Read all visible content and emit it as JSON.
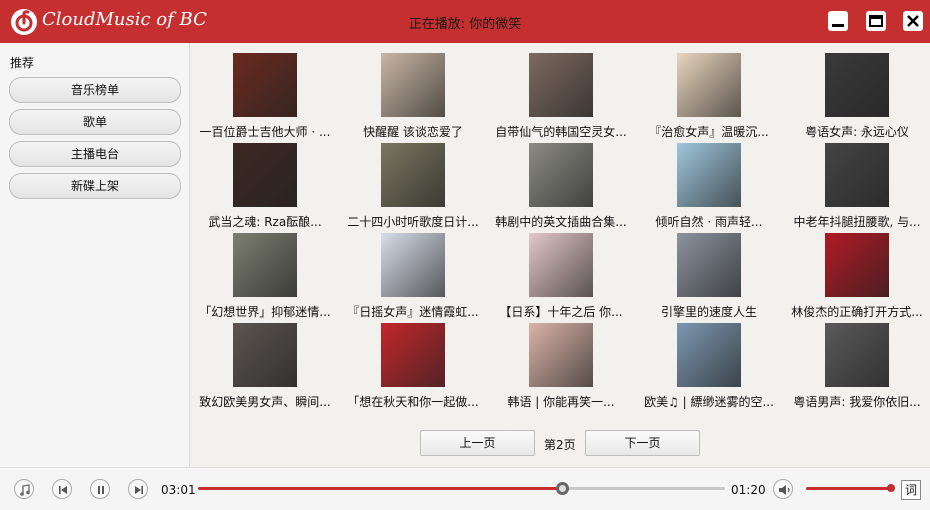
{
  "app": {
    "title": "CloudMusic of BC",
    "now_playing": "正在播放: 你的微笑"
  },
  "window_controls": {
    "minimize": "minimize-icon",
    "maximize": "maximize-icon",
    "close": "close-icon"
  },
  "sidebar": {
    "heading": "推荐",
    "items": [
      {
        "label": "音乐榜单"
      },
      {
        "label": "歌单"
      },
      {
        "label": "主播电台"
      },
      {
        "label": "新碟上架"
      }
    ]
  },
  "playlists": [
    {
      "title": "一百位爵士吉他大师 · ...",
      "color": "#6a2a20"
    },
    {
      "title": "快醒醒 该谈恋爱了",
      "color": "#c9b6a4"
    },
    {
      "title": "自带仙气的韩国空灵女...",
      "color": "#7d6a5f"
    },
    {
      "title": "『治愈女声』温暖沉...",
      "color": "#e8d5bd"
    },
    {
      "title": "粤语女声: 永远心仪",
      "color": "#3a3a3a"
    },
    {
      "title": "武当之魂: Rza酝酿...",
      "color": "#3d2822"
    },
    {
      "title": "二十四小时听歌度日计...",
      "color": "#7a7660"
    },
    {
      "title": "韩剧中的英文插曲合集...",
      "color": "#8c8c84"
    },
    {
      "title": "倾听自然 · 雨声轻...",
      "color": "#9fc6dc"
    },
    {
      "title": "中老年抖腿扭腰歌, 与...",
      "color": "#444444"
    },
    {
      "title": "「幻想世界」抑郁迷情...",
      "color": "#7c7f70"
    },
    {
      "title": "『日摇女声』迷情霞虹...",
      "color": "#d8dde8"
    },
    {
      "title": "【日系】十年之后 你...",
      "color": "#e3c7c7"
    },
    {
      "title": "引擎里的速度人生",
      "color": "#8b939e"
    },
    {
      "title": "林俊杰的正确打开方式...",
      "color": "#b01a24"
    },
    {
      "title": "致幻欧美男女声、瞬间...",
      "color": "#5c5550"
    },
    {
      "title": "「想在秋天和你一起做...",
      "color": "#c4262a"
    },
    {
      "title": "韩语 | 你能再笑一...",
      "color": "#d9b3a8"
    },
    {
      "title": "欧美♫ | 縹缈迷雾的空...",
      "color": "#7c97b0"
    },
    {
      "title": "粤语男声: 我爱你依旧...",
      "color": "#5a5a5a"
    }
  ],
  "pager": {
    "prev": "上一页",
    "page": "第2页",
    "next": "下一页"
  },
  "player": {
    "elapsed": "03:01",
    "duration": "01:20",
    "progress": 0.69,
    "volume": 1.0,
    "lyrics_label": "词",
    "icons": [
      "music-note-icon",
      "previous-icon",
      "pause-icon",
      "next-icon",
      "volume-icon"
    ]
  },
  "colors": {
    "accent": "#c62f2f"
  }
}
